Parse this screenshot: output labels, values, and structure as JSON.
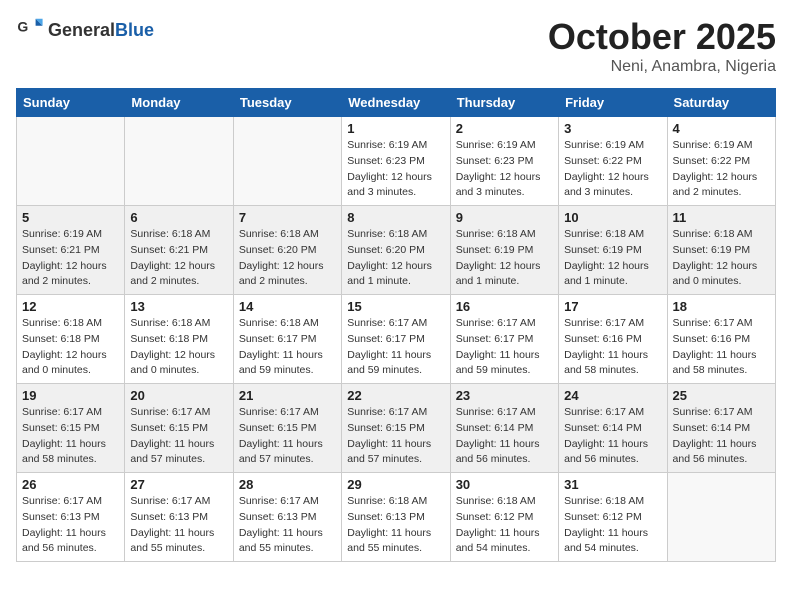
{
  "header": {
    "logo_general": "General",
    "logo_blue": "Blue",
    "title": "October 2025",
    "location": "Neni, Anambra, Nigeria"
  },
  "weekdays": [
    "Sunday",
    "Monday",
    "Tuesday",
    "Wednesday",
    "Thursday",
    "Friday",
    "Saturday"
  ],
  "weeks": [
    [
      {
        "day": "",
        "sunrise": "",
        "sunset": "",
        "daylight": "",
        "empty": true
      },
      {
        "day": "",
        "sunrise": "",
        "sunset": "",
        "daylight": "",
        "empty": true
      },
      {
        "day": "",
        "sunrise": "",
        "sunset": "",
        "daylight": "",
        "empty": true
      },
      {
        "day": "1",
        "sunrise": "Sunrise: 6:19 AM",
        "sunset": "Sunset: 6:23 PM",
        "daylight": "Daylight: 12 hours and 3 minutes."
      },
      {
        "day": "2",
        "sunrise": "Sunrise: 6:19 AM",
        "sunset": "Sunset: 6:23 PM",
        "daylight": "Daylight: 12 hours and 3 minutes."
      },
      {
        "day": "3",
        "sunrise": "Sunrise: 6:19 AM",
        "sunset": "Sunset: 6:22 PM",
        "daylight": "Daylight: 12 hours and 3 minutes."
      },
      {
        "day": "4",
        "sunrise": "Sunrise: 6:19 AM",
        "sunset": "Sunset: 6:22 PM",
        "daylight": "Daylight: 12 hours and 2 minutes."
      }
    ],
    [
      {
        "day": "5",
        "sunrise": "Sunrise: 6:19 AM",
        "sunset": "Sunset: 6:21 PM",
        "daylight": "Daylight: 12 hours and 2 minutes."
      },
      {
        "day": "6",
        "sunrise": "Sunrise: 6:18 AM",
        "sunset": "Sunset: 6:21 PM",
        "daylight": "Daylight: 12 hours and 2 minutes."
      },
      {
        "day": "7",
        "sunrise": "Sunrise: 6:18 AM",
        "sunset": "Sunset: 6:20 PM",
        "daylight": "Daylight: 12 hours and 2 minutes."
      },
      {
        "day": "8",
        "sunrise": "Sunrise: 6:18 AM",
        "sunset": "Sunset: 6:20 PM",
        "daylight": "Daylight: 12 hours and 1 minute."
      },
      {
        "day": "9",
        "sunrise": "Sunrise: 6:18 AM",
        "sunset": "Sunset: 6:19 PM",
        "daylight": "Daylight: 12 hours and 1 minute."
      },
      {
        "day": "10",
        "sunrise": "Sunrise: 6:18 AM",
        "sunset": "Sunset: 6:19 PM",
        "daylight": "Daylight: 12 hours and 1 minute."
      },
      {
        "day": "11",
        "sunrise": "Sunrise: 6:18 AM",
        "sunset": "Sunset: 6:19 PM",
        "daylight": "Daylight: 12 hours and 0 minutes."
      }
    ],
    [
      {
        "day": "12",
        "sunrise": "Sunrise: 6:18 AM",
        "sunset": "Sunset: 6:18 PM",
        "daylight": "Daylight: 12 hours and 0 minutes."
      },
      {
        "day": "13",
        "sunrise": "Sunrise: 6:18 AM",
        "sunset": "Sunset: 6:18 PM",
        "daylight": "Daylight: 12 hours and 0 minutes."
      },
      {
        "day": "14",
        "sunrise": "Sunrise: 6:18 AM",
        "sunset": "Sunset: 6:17 PM",
        "daylight": "Daylight: 11 hours and 59 minutes."
      },
      {
        "day": "15",
        "sunrise": "Sunrise: 6:17 AM",
        "sunset": "Sunset: 6:17 PM",
        "daylight": "Daylight: 11 hours and 59 minutes."
      },
      {
        "day": "16",
        "sunrise": "Sunrise: 6:17 AM",
        "sunset": "Sunset: 6:17 PM",
        "daylight": "Daylight: 11 hours and 59 minutes."
      },
      {
        "day": "17",
        "sunrise": "Sunrise: 6:17 AM",
        "sunset": "Sunset: 6:16 PM",
        "daylight": "Daylight: 11 hours and 58 minutes."
      },
      {
        "day": "18",
        "sunrise": "Sunrise: 6:17 AM",
        "sunset": "Sunset: 6:16 PM",
        "daylight": "Daylight: 11 hours and 58 minutes."
      }
    ],
    [
      {
        "day": "19",
        "sunrise": "Sunrise: 6:17 AM",
        "sunset": "Sunset: 6:15 PM",
        "daylight": "Daylight: 11 hours and 58 minutes."
      },
      {
        "day": "20",
        "sunrise": "Sunrise: 6:17 AM",
        "sunset": "Sunset: 6:15 PM",
        "daylight": "Daylight: 11 hours and 57 minutes."
      },
      {
        "day": "21",
        "sunrise": "Sunrise: 6:17 AM",
        "sunset": "Sunset: 6:15 PM",
        "daylight": "Daylight: 11 hours and 57 minutes."
      },
      {
        "day": "22",
        "sunrise": "Sunrise: 6:17 AM",
        "sunset": "Sunset: 6:15 PM",
        "daylight": "Daylight: 11 hours and 57 minutes."
      },
      {
        "day": "23",
        "sunrise": "Sunrise: 6:17 AM",
        "sunset": "Sunset: 6:14 PM",
        "daylight": "Daylight: 11 hours and 56 minutes."
      },
      {
        "day": "24",
        "sunrise": "Sunrise: 6:17 AM",
        "sunset": "Sunset: 6:14 PM",
        "daylight": "Daylight: 11 hours and 56 minutes."
      },
      {
        "day": "25",
        "sunrise": "Sunrise: 6:17 AM",
        "sunset": "Sunset: 6:14 PM",
        "daylight": "Daylight: 11 hours and 56 minutes."
      }
    ],
    [
      {
        "day": "26",
        "sunrise": "Sunrise: 6:17 AM",
        "sunset": "Sunset: 6:13 PM",
        "daylight": "Daylight: 11 hours and 56 minutes."
      },
      {
        "day": "27",
        "sunrise": "Sunrise: 6:17 AM",
        "sunset": "Sunset: 6:13 PM",
        "daylight": "Daylight: 11 hours and 55 minutes."
      },
      {
        "day": "28",
        "sunrise": "Sunrise: 6:17 AM",
        "sunset": "Sunset: 6:13 PM",
        "daylight": "Daylight: 11 hours and 55 minutes."
      },
      {
        "day": "29",
        "sunrise": "Sunrise: 6:18 AM",
        "sunset": "Sunset: 6:13 PM",
        "daylight": "Daylight: 11 hours and 55 minutes."
      },
      {
        "day": "30",
        "sunrise": "Sunrise: 6:18 AM",
        "sunset": "Sunset: 6:12 PM",
        "daylight": "Daylight: 11 hours and 54 minutes."
      },
      {
        "day": "31",
        "sunrise": "Sunrise: 6:18 AM",
        "sunset": "Sunset: 6:12 PM",
        "daylight": "Daylight: 11 hours and 54 minutes."
      },
      {
        "day": "",
        "sunrise": "",
        "sunset": "",
        "daylight": "",
        "empty": true
      }
    ]
  ]
}
